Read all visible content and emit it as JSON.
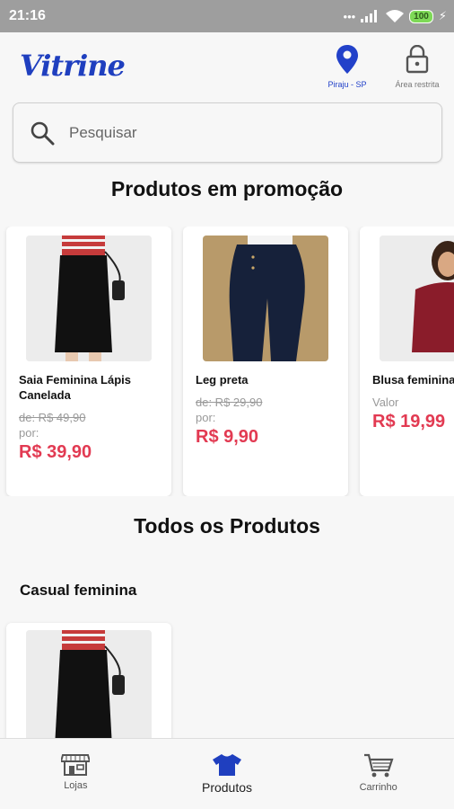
{
  "status": {
    "time": "21:16",
    "battery": "100"
  },
  "header": {
    "logo": "Vitrine",
    "location_label": "Piraju - SP",
    "restricted_label": "Área restrita"
  },
  "search": {
    "placeholder": "Pesquisar"
  },
  "promo": {
    "title": "Produtos em promoção",
    "items": [
      {
        "name": "Saia Feminina Lápis Canelada",
        "old_price": "de: R$ 49,90",
        "por": "por:",
        "price": "R$ 39,90"
      },
      {
        "name": "Leg preta",
        "old_price": "de: R$ 29,90",
        "por": "por:",
        "price": "R$ 9,90"
      },
      {
        "name": "Blusa feminina",
        "value_label": "Valor",
        "price": "R$ 19,99"
      }
    ]
  },
  "all_products": {
    "title": "Todos os Produtos",
    "category": "Casual feminina"
  },
  "nav": {
    "items": [
      {
        "label": "Lojas"
      },
      {
        "label": "Produtos"
      },
      {
        "label": "Carrinho"
      }
    ]
  },
  "colors": {
    "brand": "#1f3fbf",
    "price": "#e23a52",
    "status_bar": "#9e9e9e"
  }
}
